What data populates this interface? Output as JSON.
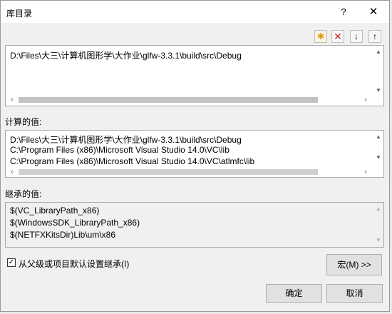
{
  "title": "库目录",
  "titlebar": {
    "help": "?",
    "close": "✕"
  },
  "toolbar": {
    "new": "✱",
    "delete": "✕",
    "down": "↓",
    "up": "↑"
  },
  "edit_box": {
    "lines": [
      "D:\\Files\\大三\\计算机图形学\\大作业\\glfw-3.3.1\\build\\src\\Debug"
    ]
  },
  "evaluated": {
    "label": "计算的值:",
    "lines": [
      "D:\\Files\\大三\\计算机图形学\\大作业\\glfw-3.3.1\\build\\src\\Debug",
      "C:\\Program Files (x86)\\Microsoft Visual Studio 14.0\\VC\\lib",
      "C:\\Program Files (x86)\\Microsoft Visual Studio 14.0\\VC\\atlmfc\\lib"
    ]
  },
  "inherited": {
    "label": "继承的值:",
    "lines": [
      "$(VC_LibraryPath_x86)",
      "$(WindowsSDK_LibraryPath_x86)",
      "$(NETFXKitsDir)Lib\\um\\x86"
    ]
  },
  "inherit_checkbox": {
    "label": "从父级或项目默认设置继承(I)",
    "checked": true,
    "mark": "✓"
  },
  "buttons": {
    "macros": "宏(M) >>",
    "ok": "确定",
    "cancel": "取消"
  }
}
